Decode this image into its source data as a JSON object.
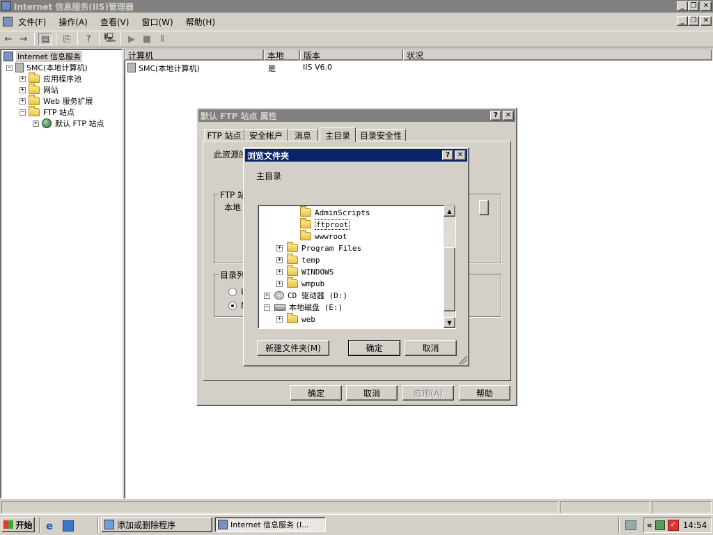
{
  "app": {
    "title": "Internet 信息服务(IIS)管理器"
  },
  "menu": {
    "items": [
      "文件(F)",
      "操作(A)",
      "查看(V)",
      "窗口(W)",
      "帮助(H)"
    ]
  },
  "tree": {
    "root": "Internet 信息服务",
    "computer": "SMC(本地计算机)",
    "app_pools": "应用程序池",
    "websites": "网站",
    "web_ext": "Web 服务扩展",
    "ftp_sites": "FTP 站点",
    "default_ftp": "默认 FTP 站点"
  },
  "list": {
    "columns": [
      "计算机",
      "本地",
      "版本",
      "状况"
    ],
    "rows": [
      {
        "computer": "SMC(本地计算机)",
        "local": "是",
        "version": "IIS V6.0",
        "status": ""
      }
    ]
  },
  "props": {
    "title": "默认 FTP 站点 属性",
    "tabs": [
      "FTP 站点",
      "安全帐户",
      "消息",
      "主目录",
      "目录安全性"
    ],
    "active_tab": "主目录",
    "text1": "此资源的",
    "group1": "FTP 站",
    "group1_line": "本地",
    "group2": "目录列",
    "radio1": "U",
    "radio2": "M",
    "ok": "确定",
    "cancel": "取消",
    "apply": "应用(A)",
    "help": "帮助"
  },
  "browse": {
    "title": "浏览文件夹",
    "caption": "主目录",
    "items": [
      {
        "label": "AdminScripts",
        "selected": false,
        "expander": ""
      },
      {
        "label": "ftproot",
        "selected": true,
        "expander": ""
      },
      {
        "label": "wwwroot",
        "selected": false,
        "expander": ""
      },
      {
        "label": "Program Files",
        "selected": false,
        "expander": "+"
      },
      {
        "label": "temp",
        "selected": false,
        "expander": "+"
      },
      {
        "label": "WINDOWS",
        "selected": false,
        "expander": "+"
      },
      {
        "label": "wmpub",
        "selected": false,
        "expander": "+"
      },
      {
        "label": "CD 驱动器 (D:)",
        "selected": false,
        "expander": "+"
      },
      {
        "label": "本地磁盘 (E:)",
        "selected": false,
        "expander": "−"
      },
      {
        "label": "web",
        "selected": false,
        "expander": "+"
      }
    ],
    "new_folder": "新建文件夹(M)",
    "ok": "确定",
    "cancel": "取消"
  },
  "taskbar": {
    "start": "开始",
    "task1": "添加或删除程序",
    "task2": "Internet 信息服务 (I...",
    "clock": "14:54"
  },
  "colors": {
    "active_title": "#0a246a",
    "inactive_title": "#808080",
    "face": "#d4d0c8",
    "selection": "#0a246a"
  }
}
